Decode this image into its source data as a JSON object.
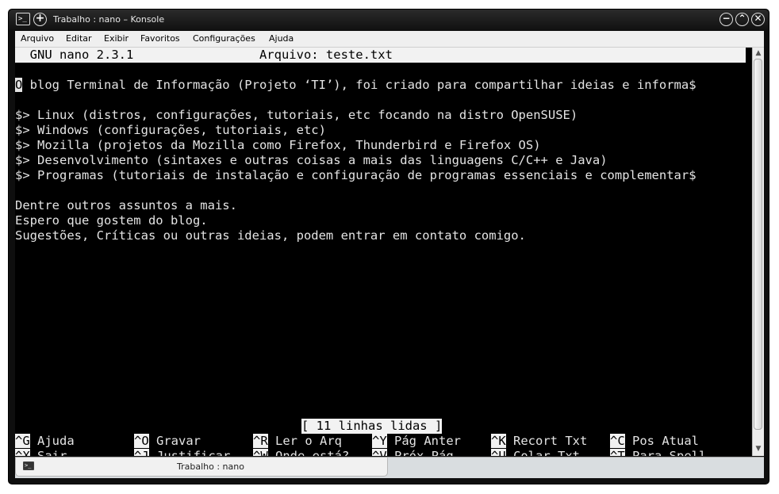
{
  "window": {
    "title": "Trabalho : nano – Konsole",
    "app_icon_glyph": ">_",
    "newtab_glyph": "+",
    "buttons": [
      "−",
      "⌃",
      "✕"
    ]
  },
  "menubar": {
    "items": [
      "Arquivo",
      "Editar",
      "Exibir",
      "Favoritos",
      "Configurações",
      "Ajuda"
    ]
  },
  "nano": {
    "header": "  GNU nano 2.3.1                 Arquivo: teste.txt",
    "cursor_char": "O",
    "lines": [
      "",
      " blog Terminal de Informação (Projeto ‘TI’), foi criado para compartilhar ideias e informa$",
      "",
      "$> Linux (distros, configurações, tutoriais, etc focando na distro OpenSUSE)",
      "$> Windows (configurações, tutoriais, etc)",
      "$> Mozilla (projetos da Mozilla como Firefox, Thunderbird e Firefox OS)",
      "$> Desenvolvimento (sintaxes e outras coisas a mais das linguagens C/C++ e Java)",
      "$> Programas (tutoriais de instalação e configuração de programas essenciais e complementar$",
      "",
      "Dentre outros assuntos a mais.",
      "Espero que gostem do blog.",
      "Sugestões, Críticas ou outras ideias, podem entrar em contato comigo."
    ],
    "status": "[ 11 linhas lidas ]",
    "shortcuts": [
      [
        {
          "key": "^G",
          "label": " Ajuda"
        },
        {
          "key": "^O",
          "label": " Gravar"
        },
        {
          "key": "^R",
          "label": " Ler o Arq"
        },
        {
          "key": "^Y",
          "label": " Pág Anter"
        },
        {
          "key": "^K",
          "label": " Recort Txt"
        },
        {
          "key": "^C",
          "label": " Pos Atual"
        }
      ],
      [
        {
          "key": "^X",
          "label": " Sair"
        },
        {
          "key": "^J",
          "label": " Justificar"
        },
        {
          "key": "^W",
          "label": " Onde está?"
        },
        {
          "key": "^V",
          "label": " Próx Pág"
        },
        {
          "key": "^U",
          "label": " Colar Txt"
        },
        {
          "key": "^T",
          "label": " Para Spell"
        }
      ]
    ]
  },
  "scrollbar": {
    "up_glyph": "▲",
    "down_glyph": "▼"
  },
  "tabbar": {
    "tab_label": "Trabalho : nano",
    "tab_icon_glyph": ">_"
  },
  "colors": {
    "terminal_bg": "#000000",
    "terminal_fg": "#e4e4e4",
    "highlight_bg": "#f2f2f2"
  }
}
